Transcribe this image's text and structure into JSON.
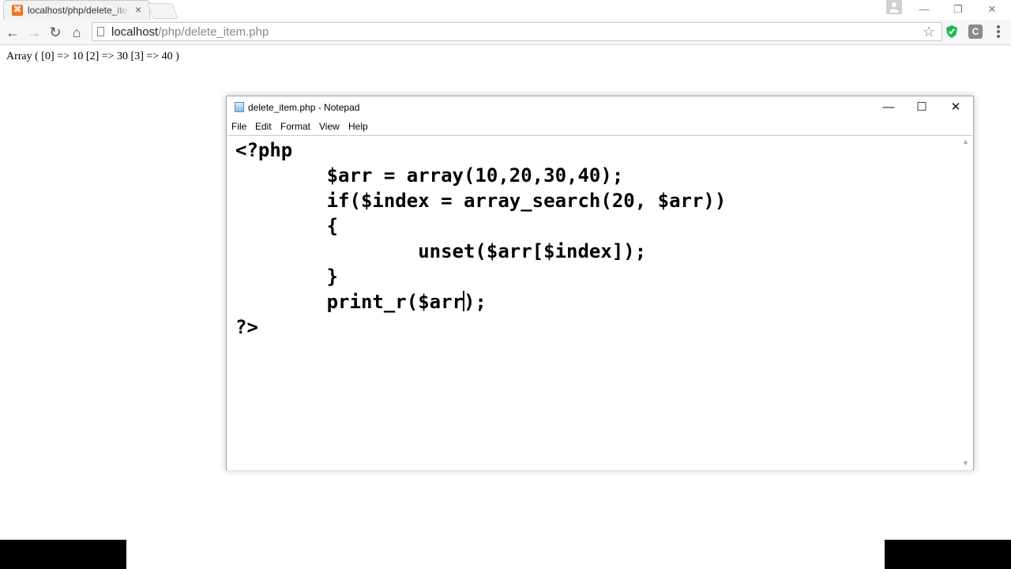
{
  "browser": {
    "tab_title": "localhost/php/delete_item.php",
    "tab_close": "×",
    "url_host": "localhost",
    "url_path": "/php/delete_item.php",
    "window_controls": {
      "minimize": "—",
      "restore": "❐",
      "close": "✕"
    },
    "extensions": [
      {
        "name": "shield-extension",
        "label": "",
        "color": "#1db954"
      },
      {
        "name": "c-extension",
        "label": "C",
        "color": "#8a8a8a"
      }
    ],
    "nav_icons": {
      "back": "←",
      "forward": "→",
      "reload": "↻",
      "home": "⌂",
      "star": "☆"
    }
  },
  "page": {
    "output_text": "Array ( [0] => 10 [2] => 30 [3] => 40 )"
  },
  "notepad": {
    "title": "delete_item.php - Notepad",
    "controls": {
      "minimize": "—",
      "maximize": "☐",
      "close": "✕"
    },
    "menu": [
      "File",
      "Edit",
      "Format",
      "View",
      "Help"
    ],
    "code_lines": [
      "<?php",
      "        $arr = array(10,20,30,40);",
      "        if($index = array_search(20, $arr))",
      "        {",
      "                unset($arr[$index]);",
      "        }",
      "        print_r($arr);",
      "?>"
    ],
    "caret_line": 6,
    "caret_after": "        print_r($arr"
  }
}
